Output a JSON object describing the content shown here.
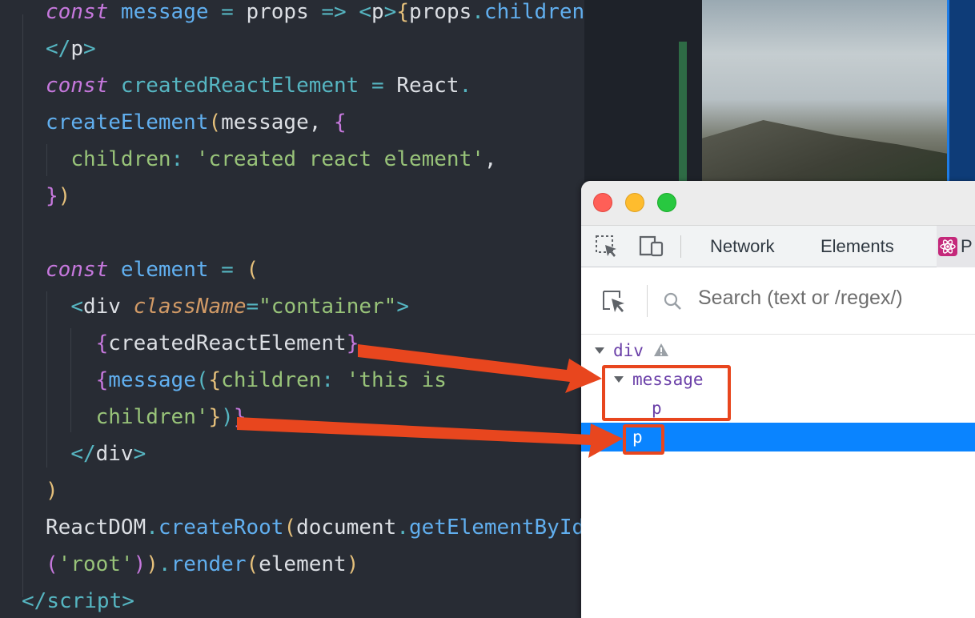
{
  "editor": {
    "lines": [
      [
        {
          "t": "const ",
          "c": "kw"
        },
        {
          "t": "message ",
          "c": "var"
        },
        {
          "t": "= ",
          "c": "op"
        },
        {
          "t": "props ",
          "c": "plain"
        },
        {
          "t": "=> ",
          "c": "op"
        },
        {
          "t": "<",
          "c": "op"
        },
        {
          "t": "p",
          "c": "plain"
        },
        {
          "t": ">",
          "c": "op"
        },
        {
          "t": "{",
          "c": "par1"
        },
        {
          "t": "props",
          "c": "plain"
        },
        {
          "t": ".",
          "c": "op"
        },
        {
          "t": "children",
          "c": "var"
        },
        {
          "t": "}",
          "c": "par1"
        }
      ],
      [
        {
          "t": "</",
          "c": "op"
        },
        {
          "t": "p",
          "c": "plain"
        },
        {
          "t": ">",
          "c": "op"
        }
      ],
      [
        {
          "t": "const ",
          "c": "kw"
        },
        {
          "t": "createdReactElement ",
          "c": "op"
        },
        {
          "t": "= ",
          "c": "op"
        },
        {
          "t": "React",
          "c": "plain"
        },
        {
          "t": ".",
          "c": "op"
        }
      ],
      [
        {
          "t": "createElement",
          "c": "fn"
        },
        {
          "t": "(",
          "c": "par1"
        },
        {
          "t": "message",
          "c": "plain"
        },
        {
          "t": ", ",
          "c": "plain"
        },
        {
          "t": "{",
          "c": "par2"
        }
      ],
      [
        {
          "t": "  "
        },
        {
          "t": "children",
          "c": "prop"
        },
        {
          "t": ": ",
          "c": "op"
        },
        {
          "t": "'created react element'",
          "c": "str"
        },
        {
          "t": ",",
          "c": "plain"
        }
      ],
      [
        {
          "t": "}",
          "c": "par2"
        },
        {
          "t": ")",
          "c": "par1"
        }
      ],
      [],
      [
        {
          "t": "const ",
          "c": "kw"
        },
        {
          "t": "element ",
          "c": "var"
        },
        {
          "t": "= ",
          "c": "op"
        },
        {
          "t": "(",
          "c": "par1"
        }
      ],
      [
        {
          "t": "  "
        },
        {
          "t": "<",
          "c": "op"
        },
        {
          "t": "div ",
          "c": "plain"
        },
        {
          "t": "className",
          "c": "attr"
        },
        {
          "t": "=",
          "c": "op"
        },
        {
          "t": "\"container\"",
          "c": "str"
        },
        {
          "t": ">",
          "c": "op"
        }
      ],
      [
        {
          "t": "    "
        },
        {
          "t": "{",
          "c": "par2"
        },
        {
          "t": "createdReactElement",
          "c": "plain"
        },
        {
          "t": "}",
          "c": "par2"
        }
      ],
      [
        {
          "t": "    "
        },
        {
          "t": "{",
          "c": "par2"
        },
        {
          "t": "message",
          "c": "fn"
        },
        {
          "t": "(",
          "c": "par3"
        },
        {
          "t": "{",
          "c": "par1"
        },
        {
          "t": "children",
          "c": "prop"
        },
        {
          "t": ": ",
          "c": "op"
        },
        {
          "t": "'this is",
          "c": "str"
        }
      ],
      [
        {
          "t": "    "
        },
        {
          "t": "children'",
          "c": "str"
        },
        {
          "t": "}",
          "c": "par1"
        },
        {
          "t": ")",
          "c": "par3"
        },
        {
          "t": "}",
          "c": "par2"
        }
      ],
      [
        {
          "t": "  "
        },
        {
          "t": "</",
          "c": "op"
        },
        {
          "t": "div",
          "c": "plain"
        },
        {
          "t": ">",
          "c": "op"
        }
      ],
      [
        {
          "t": ")",
          "c": "par1"
        }
      ],
      [
        {
          "t": "ReactDOM",
          "c": "plain"
        },
        {
          "t": ".",
          "c": "op"
        },
        {
          "t": "createRoot",
          "c": "fn"
        },
        {
          "t": "(",
          "c": "par1"
        },
        {
          "t": "document",
          "c": "plain"
        },
        {
          "t": ".",
          "c": "op"
        },
        {
          "t": "getElementById",
          "c": "fn"
        }
      ],
      [
        {
          "t": "(",
          "c": "par2"
        },
        {
          "t": "'root'",
          "c": "str"
        },
        {
          "t": ")",
          "c": "par2"
        },
        {
          "t": ")",
          "c": "par1"
        },
        {
          "t": ".",
          "c": "op"
        },
        {
          "t": "render",
          "c": "fn"
        },
        {
          "t": "(",
          "c": "par1"
        },
        {
          "t": "element",
          "c": "plain"
        },
        {
          "t": ")",
          "c": "par1"
        }
      ],
      [
        {
          "t": "</",
          "c": "op"
        },
        {
          "t": "script",
          "c": "op"
        },
        {
          "t": ">",
          "c": "op"
        }
      ]
    ]
  },
  "devtools": {
    "tabs": {
      "network": "Network",
      "elements": "Elements",
      "components_fragment": "P"
    },
    "search_placeholder": "Search (text or /regex/)",
    "tree": {
      "div": "div",
      "message": "message",
      "p_child": "p",
      "p_selected": "p"
    }
  },
  "colors": {
    "annotation": "#e8461e",
    "selection": "#0a84ff",
    "component_name": "#6a3fa8"
  },
  "icons": [
    "select-element-icon",
    "device-toolbar-icon",
    "react-icon",
    "inspect-icon",
    "search-icon",
    "warning-icon",
    "caret-down-icon"
  ]
}
